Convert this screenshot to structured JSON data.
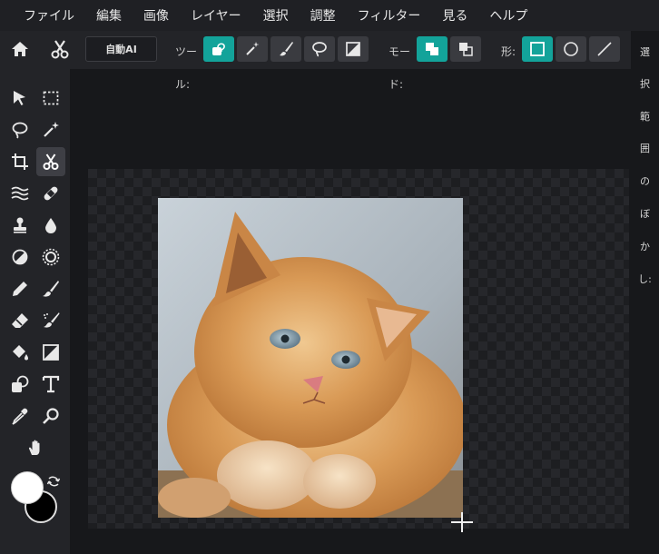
{
  "menu": [
    "ファイル",
    "編集",
    "画像",
    "レイヤー",
    "選択",
    "調整",
    "フィルター",
    "見る",
    "ヘルプ"
  ],
  "options": {
    "auto_ai": "自動AI",
    "tool_label_top": "ツー",
    "tool_label_bottom": "ル:",
    "mode_label_top": "モー",
    "mode_label_bottom": "ド:",
    "shape_label": "形:",
    "tool_icons": [
      "lasso-fill-icon",
      "magic-wand-icon",
      "brush-icon",
      "lasso-icon",
      "gradient-square-icon"
    ],
    "mode_icons": [
      "mode-add-icon",
      "mode-subtract-icon"
    ],
    "shape_icons": [
      "rectangle-icon",
      "ellipse-icon",
      "line-icon"
    ]
  },
  "right_panel": {
    "chars": [
      "選",
      "択",
      "範",
      "囲",
      "の",
      "ぼ",
      "か",
      "し:"
    ]
  },
  "toolbar": {
    "tools": [
      "select-arrow-icon",
      "marquee-icon",
      "lasso-icon",
      "magic-wand-icon",
      "crop-icon",
      "scissors-icon",
      "liquify-icon",
      "bandage-icon",
      "stamp-icon",
      "drop-icon",
      "dodge-icon",
      "sun-icon",
      "pencil-icon",
      "brush-icon",
      "eraser-icon",
      "spray-brush-icon",
      "paint-bucket-icon",
      "gradient-icon",
      "shape-icon",
      "text-icon",
      "eyedropper-icon",
      "zoom-icon",
      "hand-icon"
    ]
  },
  "colors": {
    "accent": "#13a39a",
    "foreground": "#ffffff",
    "background": "#000000"
  }
}
